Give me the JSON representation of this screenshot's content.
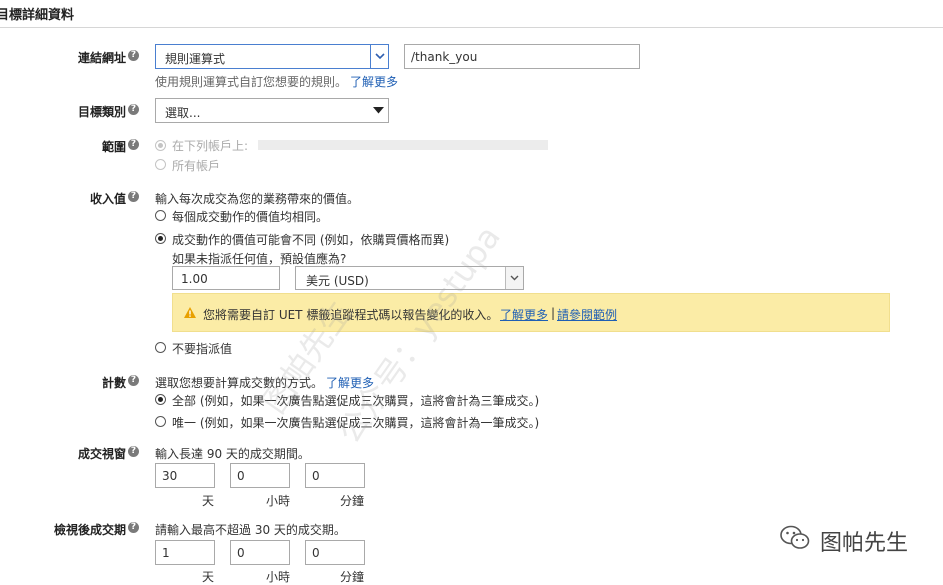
{
  "section_title": "目標詳細資料",
  "link_url": {
    "label": "連結網址",
    "select_value": "規則運算式",
    "input_value": "/thank_you",
    "help_text": "使用規則運算式自訂您想要的規則。",
    "learn_more": "了解更多"
  },
  "goal_category": {
    "label": "目標類別",
    "select_value": "選取..."
  },
  "scope": {
    "label": "範圍",
    "option_1": "在下列帳戶上:",
    "option_2": "所有帳戶"
  },
  "revenue": {
    "label": "收入值",
    "description": "輸入每次成交為您的業務帶來的價值。",
    "option_same": "每個成交動作的價值均相同。",
    "option_vary": "成交動作的價值可能會不同 (例如，依購買價格而異)",
    "default_prompt": "如果未指派任何值，預設值應為?",
    "amount_value": "1.00",
    "currency_value": "美元 (USD)",
    "warning_text": "您將需要自訂 UET 標籤追蹤程式碼以報告變化的收入。",
    "warning_learn_more": "了解更多",
    "warning_separator": "|",
    "warning_example": "請參閱範例",
    "option_none": "不要指派值"
  },
  "count": {
    "label": "計數",
    "description": "選取您想要計算成交數的方式。",
    "learn_more": "了解更多",
    "option_all": "全部 (例如，如果一次廣告點選促成三次購買，這將會計為三筆成交。)",
    "option_unique": "唯一 (例如，如果一次廣告點選促成三次購買，這將會計為一筆成交。)"
  },
  "conversion_window": {
    "label": "成交視窗",
    "description": "輸入長達 90 天的成交期間。",
    "days_value": "30",
    "hours_value": "0",
    "minutes_value": "0",
    "days_unit": "天",
    "hours_unit": "小時",
    "minutes_unit": "分鐘"
  },
  "view_through": {
    "label": "檢視後成交期",
    "description": "請輸入最高不超過 30 天的成交期。",
    "days_value": "1",
    "hours_value": "0",
    "minutes_value": "0",
    "days_unit": "天",
    "hours_unit": "小時",
    "minutes_unit": "分鐘"
  },
  "watermarks": {
    "diagonal_1": "图帕先生",
    "diagonal_2": "公众号：yestupa",
    "brand": "图帕先生"
  },
  "colors": {
    "link": "#1f5fb4",
    "warning_bg": "#fbeca6",
    "warning_icon": "#e8a100",
    "select_focus": "#4a7fd0"
  }
}
